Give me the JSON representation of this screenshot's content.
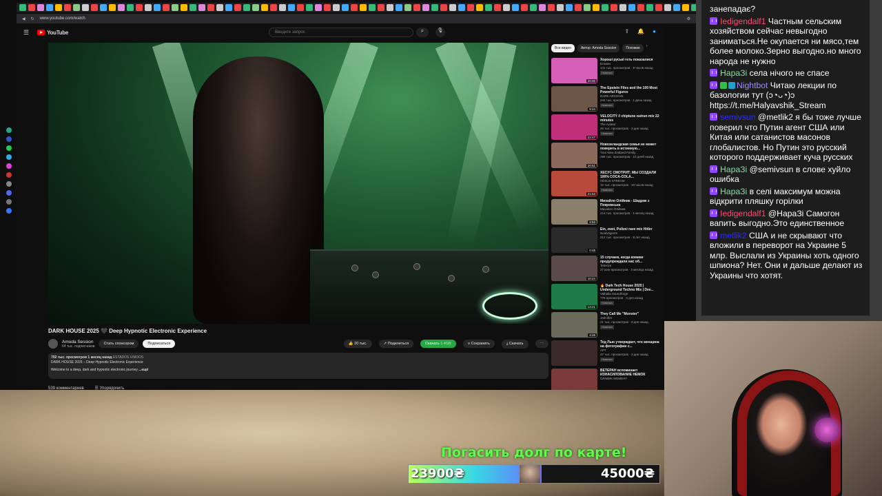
{
  "browser": {
    "url": "www.youtube.com/watch",
    "tab_colors": [
      "#3b7",
      "#e44",
      "#d8d",
      "#4af",
      "#fb0",
      "#e44",
      "#8c8",
      "#ccc",
      "#e44",
      "#4af",
      "#fb0",
      "#d8d",
      "#3b7",
      "#e44",
      "#ccc",
      "#4af",
      "#e44",
      "#8c8",
      "#fb0",
      "#3b7",
      "#d8d",
      "#e44",
      "#ccc",
      "#4af",
      "#e44",
      "#3b7",
      "#8c8",
      "#fb0",
      "#e44",
      "#ccc",
      "#4af",
      "#e44",
      "#3b7",
      "#d8d",
      "#e44",
      "#ccc",
      "#4af",
      "#e44",
      "#fb0",
      "#3b7",
      "#e44",
      "#ccc",
      "#4af",
      "#8c8",
      "#e44",
      "#d8d",
      "#3b7",
      "#e44",
      "#ccc",
      "#4af",
      "#e44",
      "#fb0",
      "#3b7",
      "#e44",
      "#ccc",
      "#4af",
      "#e44",
      "#3b7",
      "#d8d",
      "#e44",
      "#ccc",
      "#4af",
      "#e44",
      "#8c8",
      "#fb0",
      "#3b7",
      "#e44",
      "#ccc",
      "#4af",
      "#e44",
      "#3b7",
      "#e44",
      "#ccc",
      "#4af",
      "#fb0",
      "#3b7"
    ]
  },
  "side_strip_colors": [
    "#2a8",
    "#35c",
    "#2c5",
    "#3ae",
    "#d4d",
    "#c33",
    "#888",
    "#56e",
    "#777",
    "#37f"
  ],
  "youtube": {
    "logo_text": "YouTube",
    "search_placeholder": "Введите запрос",
    "video": {
      "title": "DARK HOUSE 2025 🖤 Deep Hypnotic Electronic Experience",
      "channel": "Amoda Session",
      "subscribers": "64 тыс. подписчиков",
      "subscribe_label": "Стать спонсором",
      "subscribed_label": "Подписаться",
      "likes": "20 тыс.",
      "share_label": "Поделиться",
      "download_label": "Скачать",
      "download_size": "1.4GB",
      "save_label": "Сохранить",
      "download2_label": "Скачать",
      "views_line": "702 тыс. просмотров  1 месяц назад",
      "location": "ESTADOS UNIDOS",
      "desc_line1": "DARK HOUSE 2025 – Deep Hypnotic Electronic Experience",
      "desc_line2": "Welcome to a deep, dark and hypnotic electronic journey",
      "more_label": "...ещё",
      "comments_count": "539 комментариев",
      "sort_label": "Упорядочить"
    },
    "chips": [
      "Все видео",
      "Автор: Amoda Session",
      "Похожие"
    ],
    "recommendations": [
      {
        "title": "Хороші руські геть показалися",
        "channel": "Елькин",
        "meta": "141 тыс. просмотров · 9 часов назад",
        "badge": "Новинка",
        "duration": "26:05",
        "color": "#d65fb8"
      },
      {
        "title": "The Epstein Files and the 100 Most Powerful Figures",
        "channel": "DARK ARCHIVE",
        "meta": "244 тыс. просмотров · 1 день назад",
        "badge": "Новинка",
        "duration": "9:24",
        "color": "#6b5548"
      },
      {
        "title": "VELOCITY // chiptune outrun mix 22 minutes",
        "channel": "The Aviator",
        "meta": "20 тыс. просмотров · 3 дня назад",
        "badge": "Новинка",
        "duration": "22:47",
        "color": "#c0307a"
      },
      {
        "title": "Новозеландская семья не может поверить в истинную...",
        "channel": "Your New Zealand Family",
        "meta": "296 тыс. просмотров · 10 дней назад",
        "badge": "",
        "duration": "20:51",
        "color": "#8a6a5a"
      },
      {
        "title": "ХЕСУС СМОТРИТ: МЫ СОЗДАЛИ 100% COCA-COLA...",
        "channel": "HESUS STREAM",
        "meta": "10 тыс. просмотров · 10 часов назад",
        "badge": "Новинка",
        "duration": "21:53",
        "color": "#b74a3a"
      },
      {
        "title": "Михайло Олійник - Шадрик з Покровська",
        "channel": "Михайло Олійник",
        "meta": "214 тыс. просмотров · 1 месяц назад",
        "badge": "",
        "duration": "2:53",
        "color": "#8a7f6a"
      },
      {
        "title": "Ein, zwei, Polizei rave mix Hitler",
        "channel": "Noobzigiorm",
        "meta": "212 тыс. просмотров · 8 лет назад",
        "badge": "",
        "duration": "0:48",
        "color": "#2a2a2a"
      },
      {
        "title": "15 случаев, когда комики предупреждали нас об...",
        "channel": "Televize",
        "meta": "27 млн просмотров · 3 месяца назад",
        "badge": "",
        "duration": "10:24",
        "color": "#5a4a4a"
      },
      {
        "title": "🔥 Dark Tech House 2025 | Underground Techno Mix | Dee...",
        "channel": "Valhalla Soundforge",
        "meta": "778 просмотров · 3 дня назад",
        "badge": "Новинка",
        "duration": "13:21",
        "color": "#1f7a4a"
      },
      {
        "title": "They Call Me \"Monster\"",
        "channel": "Jarlnifter",
        "meta": "21 тыс. просмотров · 3 дня назад",
        "badge": "Новинка",
        "duration": "4:26",
        "color": "#6a6a5a"
      },
      {
        "title": "Тед Лью утверждает, что женщина на фотографии с...",
        "channel": "АРТ",
        "meta": "47 тыс. просмотров · 3 дня назад",
        "badge": "Новинка",
        "duration": "",
        "color": "#3a2a2a"
      },
      {
        "title": "ВЕТЕРАН вспоминает ИЗНАСИЛОВАНИЕ НЕМОК",
        "channel": "СЛАВИК МОМЕНТ",
        "meta": "",
        "badge": "",
        "duration": "",
        "color": "#7a3a3a"
      }
    ]
  },
  "donation": {
    "title": "Погасить долг по карте!",
    "current": "23900₴",
    "goal": "45000₴",
    "progress": 0.531
  },
  "chat": {
    "messages": [
      {
        "user": "",
        "color": "#fff",
        "text": "занепадає?",
        "badges": []
      },
      {
        "user": "Iedigendalf1",
        "color": "#ff4b6e",
        "text": "Частным сельским хозяйством сейчас невыгодно заниматься.Не окупается ни мясо,тем более молоко.Зерно выгодно.но много народа не нужно",
        "badges": []
      },
      {
        "user": "НараЗі",
        "color": "#8fd6a5",
        "text": "села нічого не спасе",
        "badges": []
      },
      {
        "user": "Nightbot",
        "color": "#9a8cff",
        "text": "Читаю лекции по базологии тут (ↄ◔ᴗ◔)ↄ https://t.me/Halyavshik_Stream",
        "badges": [
          "#2fbf4a",
          "#1f9fd0"
        ]
      },
      {
        "user": "semivsun",
        "color": "#2d2dff",
        "text": "@metlik2 я бы тоже лучше поверил что Путин агент США или Китая или сатанистов масонов глобалистов. Но Путин это русский которого поддерживает куча русских",
        "badges": []
      },
      {
        "user": "НараЗі",
        "color": "#8fd6a5",
        "text": "@semivsun в слове хуйло ошибка",
        "badges": []
      },
      {
        "user": "НараЗі",
        "color": "#8fd6a5",
        "text": "в селі максимум можна відкрити пляшку горілки",
        "badges": []
      },
      {
        "user": "Iedigendalf1",
        "color": "#ff4b6e",
        "text": "@НараЗі Самогон вапить выгодно.Это единственное",
        "badges": []
      },
      {
        "user": "metlik2",
        "color": "#2d2dff",
        "text": "США и не скрывают что вложили в переворот на Украине 5 млр. Выслали из Украины хоть одного шпиона? Нет. Они и дальше делают из Украины что хотят.",
        "badges": []
      }
    ]
  }
}
